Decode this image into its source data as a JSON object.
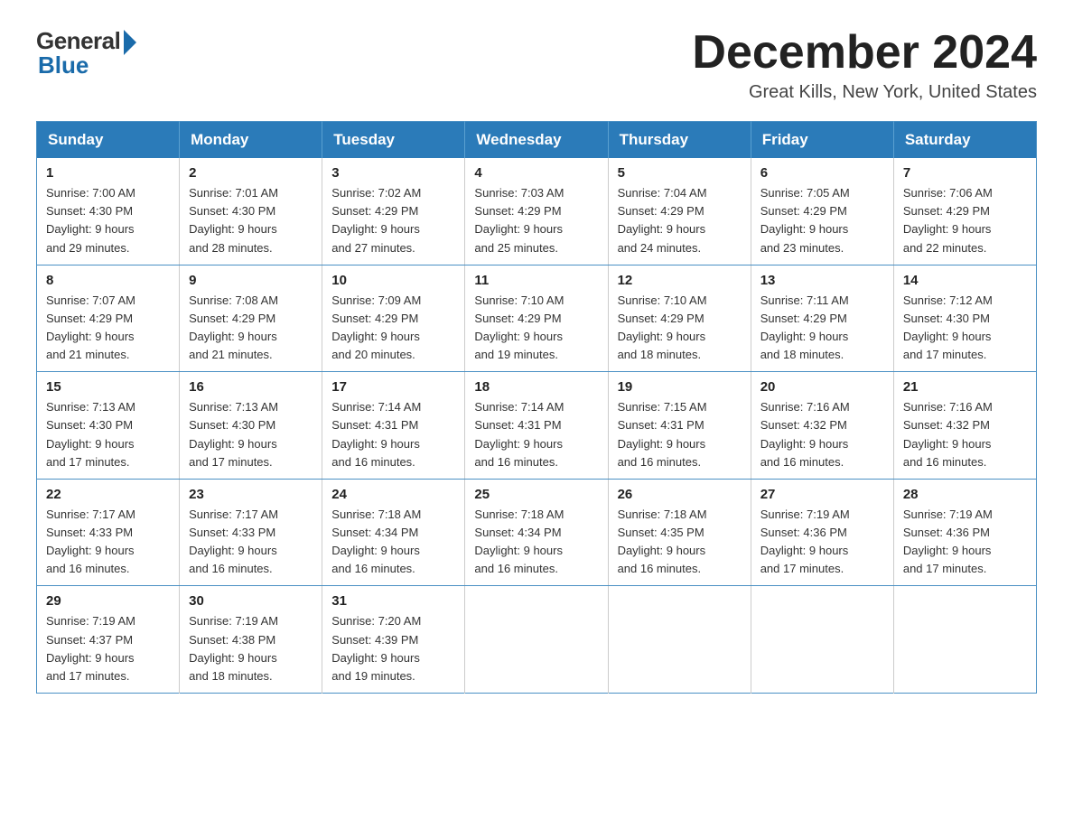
{
  "header": {
    "logo_general": "General",
    "logo_blue": "Blue",
    "month_title": "December 2024",
    "location": "Great Kills, New York, United States"
  },
  "weekdays": [
    "Sunday",
    "Monday",
    "Tuesday",
    "Wednesday",
    "Thursday",
    "Friday",
    "Saturday"
  ],
  "weeks": [
    [
      {
        "day": "1",
        "sunrise": "7:00 AM",
        "sunset": "4:30 PM",
        "daylight": "9 hours and 29 minutes."
      },
      {
        "day": "2",
        "sunrise": "7:01 AM",
        "sunset": "4:30 PM",
        "daylight": "9 hours and 28 minutes."
      },
      {
        "day": "3",
        "sunrise": "7:02 AM",
        "sunset": "4:29 PM",
        "daylight": "9 hours and 27 minutes."
      },
      {
        "day": "4",
        "sunrise": "7:03 AM",
        "sunset": "4:29 PM",
        "daylight": "9 hours and 25 minutes."
      },
      {
        "day": "5",
        "sunrise": "7:04 AM",
        "sunset": "4:29 PM",
        "daylight": "9 hours and 24 minutes."
      },
      {
        "day": "6",
        "sunrise": "7:05 AM",
        "sunset": "4:29 PM",
        "daylight": "9 hours and 23 minutes."
      },
      {
        "day": "7",
        "sunrise": "7:06 AM",
        "sunset": "4:29 PM",
        "daylight": "9 hours and 22 minutes."
      }
    ],
    [
      {
        "day": "8",
        "sunrise": "7:07 AM",
        "sunset": "4:29 PM",
        "daylight": "9 hours and 21 minutes."
      },
      {
        "day": "9",
        "sunrise": "7:08 AM",
        "sunset": "4:29 PM",
        "daylight": "9 hours and 21 minutes."
      },
      {
        "day": "10",
        "sunrise": "7:09 AM",
        "sunset": "4:29 PM",
        "daylight": "9 hours and 20 minutes."
      },
      {
        "day": "11",
        "sunrise": "7:10 AM",
        "sunset": "4:29 PM",
        "daylight": "9 hours and 19 minutes."
      },
      {
        "day": "12",
        "sunrise": "7:10 AM",
        "sunset": "4:29 PM",
        "daylight": "9 hours and 18 minutes."
      },
      {
        "day": "13",
        "sunrise": "7:11 AM",
        "sunset": "4:29 PM",
        "daylight": "9 hours and 18 minutes."
      },
      {
        "day": "14",
        "sunrise": "7:12 AM",
        "sunset": "4:30 PM",
        "daylight": "9 hours and 17 minutes."
      }
    ],
    [
      {
        "day": "15",
        "sunrise": "7:13 AM",
        "sunset": "4:30 PM",
        "daylight": "9 hours and 17 minutes."
      },
      {
        "day": "16",
        "sunrise": "7:13 AM",
        "sunset": "4:30 PM",
        "daylight": "9 hours and 17 minutes."
      },
      {
        "day": "17",
        "sunrise": "7:14 AM",
        "sunset": "4:31 PM",
        "daylight": "9 hours and 16 minutes."
      },
      {
        "day": "18",
        "sunrise": "7:14 AM",
        "sunset": "4:31 PM",
        "daylight": "9 hours and 16 minutes."
      },
      {
        "day": "19",
        "sunrise": "7:15 AM",
        "sunset": "4:31 PM",
        "daylight": "9 hours and 16 minutes."
      },
      {
        "day": "20",
        "sunrise": "7:16 AM",
        "sunset": "4:32 PM",
        "daylight": "9 hours and 16 minutes."
      },
      {
        "day": "21",
        "sunrise": "7:16 AM",
        "sunset": "4:32 PM",
        "daylight": "9 hours and 16 minutes."
      }
    ],
    [
      {
        "day": "22",
        "sunrise": "7:17 AM",
        "sunset": "4:33 PM",
        "daylight": "9 hours and 16 minutes."
      },
      {
        "day": "23",
        "sunrise": "7:17 AM",
        "sunset": "4:33 PM",
        "daylight": "9 hours and 16 minutes."
      },
      {
        "day": "24",
        "sunrise": "7:18 AM",
        "sunset": "4:34 PM",
        "daylight": "9 hours and 16 minutes."
      },
      {
        "day": "25",
        "sunrise": "7:18 AM",
        "sunset": "4:34 PM",
        "daylight": "9 hours and 16 minutes."
      },
      {
        "day": "26",
        "sunrise": "7:18 AM",
        "sunset": "4:35 PM",
        "daylight": "9 hours and 16 minutes."
      },
      {
        "day": "27",
        "sunrise": "7:19 AM",
        "sunset": "4:36 PM",
        "daylight": "9 hours and 17 minutes."
      },
      {
        "day": "28",
        "sunrise": "7:19 AM",
        "sunset": "4:36 PM",
        "daylight": "9 hours and 17 minutes."
      }
    ],
    [
      {
        "day": "29",
        "sunrise": "7:19 AM",
        "sunset": "4:37 PM",
        "daylight": "9 hours and 17 minutes."
      },
      {
        "day": "30",
        "sunrise": "7:19 AM",
        "sunset": "4:38 PM",
        "daylight": "9 hours and 18 minutes."
      },
      {
        "day": "31",
        "sunrise": "7:20 AM",
        "sunset": "4:39 PM",
        "daylight": "9 hours and 19 minutes."
      },
      null,
      null,
      null,
      null
    ]
  ]
}
